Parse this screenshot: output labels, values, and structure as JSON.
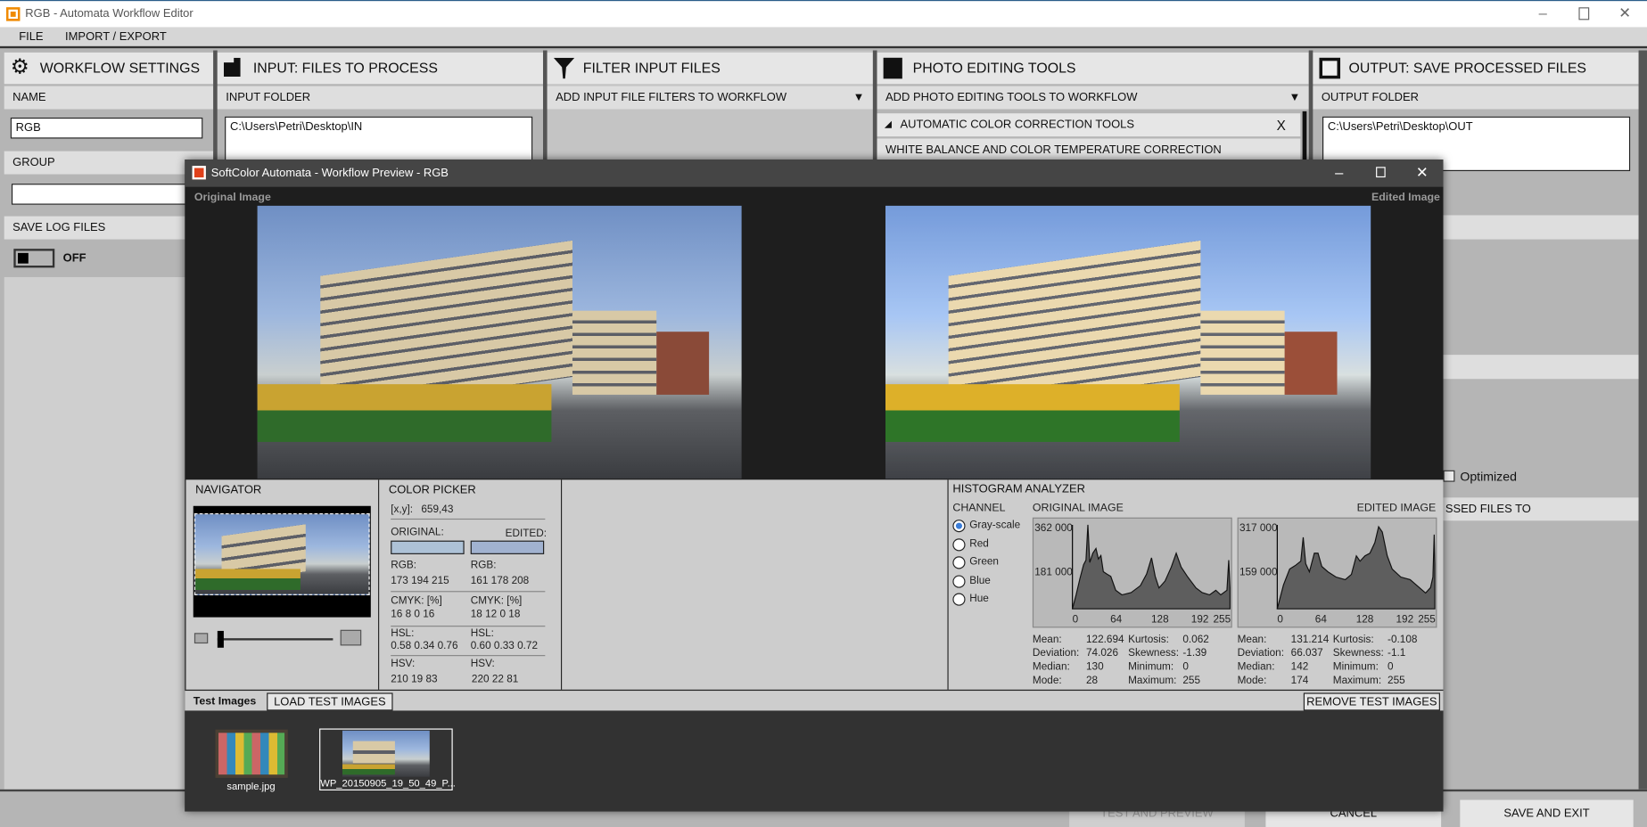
{
  "app": {
    "title": "RGB - Automata Workflow Editor",
    "menu": [
      "FILE",
      "IMPORT / EXPORT"
    ]
  },
  "columns": {
    "workflow": {
      "title": "WORKFLOW SETTINGS",
      "name_label": "NAME",
      "name_value": "RGB",
      "group_label": "GROUP",
      "group_value": "",
      "log_label": "SAVE LOG FILES",
      "log_state": "OFF"
    },
    "input": {
      "title": "INPUT: FILES TO PROCESS",
      "folder_label": "INPUT FOLDER",
      "folder_value": "C:\\Users\\Petri\\Desktop\\IN"
    },
    "filter": {
      "title": "FILTER INPUT FILES",
      "add_label": "ADD INPUT FILE FILTERS TO WORKFLOW"
    },
    "tools": {
      "title": "PHOTO EDITING TOOLS",
      "add_label": "ADD PHOTO EDITING TOOLS TO WORKFLOW",
      "group": "AUTOMATIC COLOR CORRECTION TOOLS",
      "close": "X",
      "item": "WHITE BALANCE AND COLOR TEMPERATURE CORRECTION"
    },
    "output": {
      "title": "OUTPUT: SAVE PROCESSED FILES",
      "folder_label": "OUTPUT FOLDER",
      "folder_value": "C:\\Users\\Petri\\Desktop\\OUT",
      "optimized_label": "Optimized",
      "optimized_checked": false,
      "save_to_partial": "SSED FILES TO"
    }
  },
  "bottom": {
    "test": "TEST AND PREVIEW",
    "cancel": "CANCEL",
    "save": "SAVE AND EXIT"
  },
  "preview": {
    "title": "SoftColor Automata - Workflow Preview -  RGB",
    "original_label": "Original Image",
    "edited_label": "Edited Image",
    "navigator": {
      "title": "NAVIGATOR",
      "zoom": 0
    },
    "picker": {
      "title": "COLOR PICKER",
      "xy_label": "[x,y]:",
      "xy": "659,43",
      "orig_label": "ORIGINAL:",
      "edit_label": "EDITED:",
      "orig_color": "#adc2d7",
      "edit_color": "#a1b2d0",
      "rgb_label": "RGB:",
      "orig_rgb": "173 194 215",
      "edit_rgb": "161 178 208",
      "cmyk_label": "CMYK: [%]",
      "orig_cmyk": "16 8 0 16",
      "edit_cmyk": "18 12 0 18",
      "hsl_label": "HSL:",
      "orig_hsl": "0.58 0.34 0.76",
      "edit_hsl": "0.60 0.33 0.72",
      "hsv_label": "HSV:",
      "orig_hsv": "210 19 83",
      "edit_hsv": "220 22 81"
    },
    "histogram": {
      "title": "HISTOGRAM ANALYZER",
      "channel_label": "CHANNEL",
      "channels": [
        "Gray-scale",
        "Red",
        "Green",
        "Blue",
        "Hue"
      ],
      "selected": "Gray-scale",
      "original": {
        "label": "ORIGINAL IMAGE",
        "ymax": "362 000",
        "ymid": "181 000",
        "xticks": [
          "0",
          "64",
          "128",
          "192",
          "255"
        ],
        "counts": [
          [
            0,
            0
          ],
          [
            6,
            60000
          ],
          [
            12,
            130000
          ],
          [
            18,
            190000
          ],
          [
            22,
            210000
          ],
          [
            25,
            362000
          ],
          [
            28,
            200000
          ],
          [
            33,
            240000
          ],
          [
            38,
            260000
          ],
          [
            42,
            215000
          ],
          [
            46,
            230000
          ],
          [
            50,
            160000
          ],
          [
            56,
            150000
          ],
          [
            62,
            140000
          ],
          [
            70,
            80000
          ],
          [
            80,
            60000
          ],
          [
            95,
            70000
          ],
          [
            110,
            100000
          ],
          [
            120,
            150000
          ],
          [
            128,
            220000
          ],
          [
            134,
            140000
          ],
          [
            140,
            90000
          ],
          [
            150,
            120000
          ],
          [
            160,
            180000
          ],
          [
            168,
            240000
          ],
          [
            176,
            180000
          ],
          [
            186,
            140000
          ],
          [
            200,
            90000
          ],
          [
            210,
            70000
          ],
          [
            222,
            60000
          ],
          [
            232,
            80000
          ],
          [
            240,
            60000
          ],
          [
            250,
            80000
          ],
          [
            253,
            210000
          ],
          [
            255,
            90000
          ]
        ],
        "stats": [
          [
            "Mean:",
            "122.694"
          ],
          [
            "Deviation:",
            "74.026"
          ],
          [
            "Median:",
            "130"
          ],
          [
            "Mode:",
            "28"
          ]
        ],
        "stats2": [
          [
            "Kurtosis:",
            "0.062"
          ],
          [
            "Skewness:",
            "-1.39"
          ],
          [
            "Minimum:",
            "0"
          ],
          [
            "Maximum:",
            "255"
          ]
        ]
      },
      "edited": {
        "label": "EDITED IMAGE",
        "ymax": "317 000",
        "ymid": "159 000",
        "xticks": [
          "0",
          "64",
          "128",
          "192",
          "255"
        ],
        "counts": [
          [
            0,
            0
          ],
          [
            10,
            90000
          ],
          [
            20,
            150000
          ],
          [
            30,
            165000
          ],
          [
            38,
            180000
          ],
          [
            42,
            270000
          ],
          [
            46,
            170000
          ],
          [
            52,
            140000
          ],
          [
            60,
            210000
          ],
          [
            66,
            210000
          ],
          [
            72,
            160000
          ],
          [
            82,
            140000
          ],
          [
            95,
            120000
          ],
          [
            110,
            110000
          ],
          [
            120,
            130000
          ],
          [
            128,
            200000
          ],
          [
            134,
            180000
          ],
          [
            142,
            200000
          ],
          [
            150,
            210000
          ],
          [
            158,
            250000
          ],
          [
            164,
            310000
          ],
          [
            170,
            290000
          ],
          [
            178,
            200000
          ],
          [
            186,
            150000
          ],
          [
            200,
            120000
          ],
          [
            215,
            110000
          ],
          [
            225,
            90000
          ],
          [
            240,
            60000
          ],
          [
            248,
            80000
          ],
          [
            252,
            120000
          ],
          [
            254,
            280000
          ],
          [
            255,
            170000
          ]
        ],
        "stats": [
          [
            "Mean:",
            "131.214"
          ],
          [
            "Deviation:",
            "66.037"
          ],
          [
            "Median:",
            "142"
          ],
          [
            "Mode:",
            "174"
          ]
        ],
        "stats2": [
          [
            "Kurtosis:",
            "-0.108"
          ],
          [
            "Skewness:",
            "-1.1"
          ],
          [
            "Minimum:",
            "0"
          ],
          [
            "Maximum:",
            "255"
          ]
        ]
      }
    },
    "test_images": {
      "label": "Test Images",
      "load": "LOAD TEST IMAGES",
      "remove": "REMOVE TEST IMAGES",
      "items": [
        "sample.jpg",
        "WP_20150905_19_50_49_P..."
      ]
    }
  },
  "colors": {
    "accent": "#3b7dd8",
    "logo": "#e0401a"
  }
}
